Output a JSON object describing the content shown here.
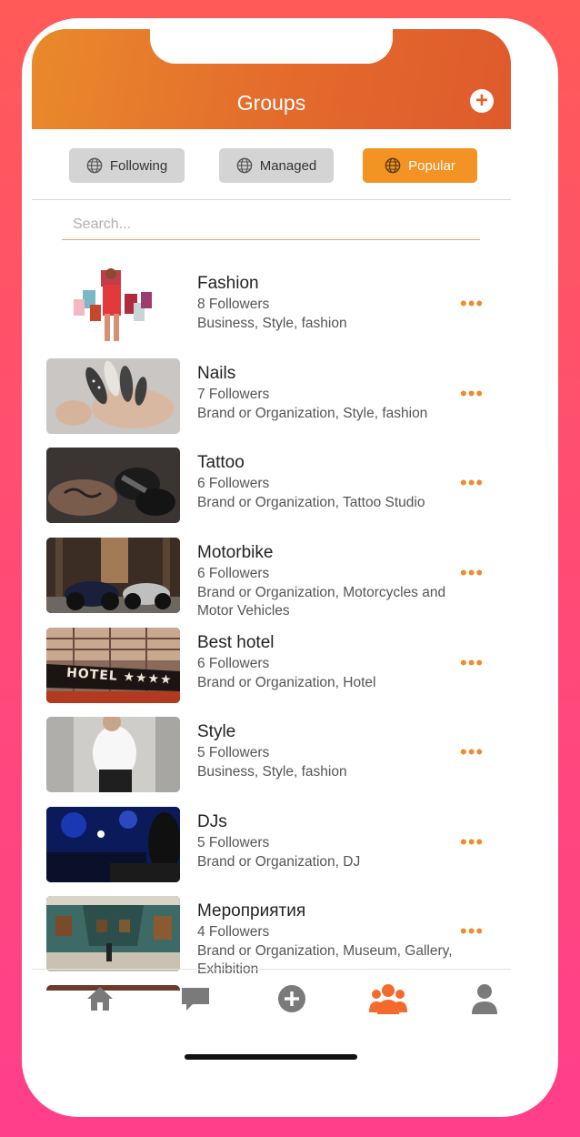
{
  "header": {
    "title": "Groups"
  },
  "tabs": [
    {
      "label": "Following",
      "active": false
    },
    {
      "label": "Managed",
      "active": false
    },
    {
      "label": "Popular",
      "active": true
    }
  ],
  "search": {
    "placeholder": "Search...",
    "value": ""
  },
  "groups": [
    {
      "name": "Fashion",
      "followers": "8 Followers",
      "category": "Business, Style, fashion"
    },
    {
      "name": "Nails",
      "followers": "7 Followers",
      "category": "Brand or Organization, Style, fashion"
    },
    {
      "name": "Tattoo",
      "followers": "6 Followers",
      "category": "Brand or Organization, Tattoo Studio"
    },
    {
      "name": "Motorbike",
      "followers": "6 Followers",
      "category": "Brand or Organization, Motorcycles and Motor Vehicles"
    },
    {
      "name": "Best hotel",
      "followers": "6 Followers",
      "category": "Brand or Organization, Hotel"
    },
    {
      "name": "Style",
      "followers": "5 Followers",
      "category": "Business, Style, fashion"
    },
    {
      "name": "DJs",
      "followers": "5 Followers",
      "category": "Brand or Organization, DJ"
    },
    {
      "name": "Мероприятия",
      "followers": "4 Followers",
      "category": "Brand or Organization, Museum, Gallery, Exhibition"
    }
  ],
  "hotel_sign": "HOTEL ★★★★",
  "tabbar": [
    {
      "icon": "home-icon",
      "active": false
    },
    {
      "icon": "chat-icon",
      "active": false
    },
    {
      "icon": "add-icon",
      "active": false
    },
    {
      "icon": "groups-icon",
      "active": true
    },
    {
      "icon": "profile-icon",
      "active": false
    }
  ],
  "colors": {
    "accent": "#f39323",
    "header_start": "#e98a2b",
    "header_end": "#df5a2c",
    "inactive_icon": "#7a7a7a"
  }
}
